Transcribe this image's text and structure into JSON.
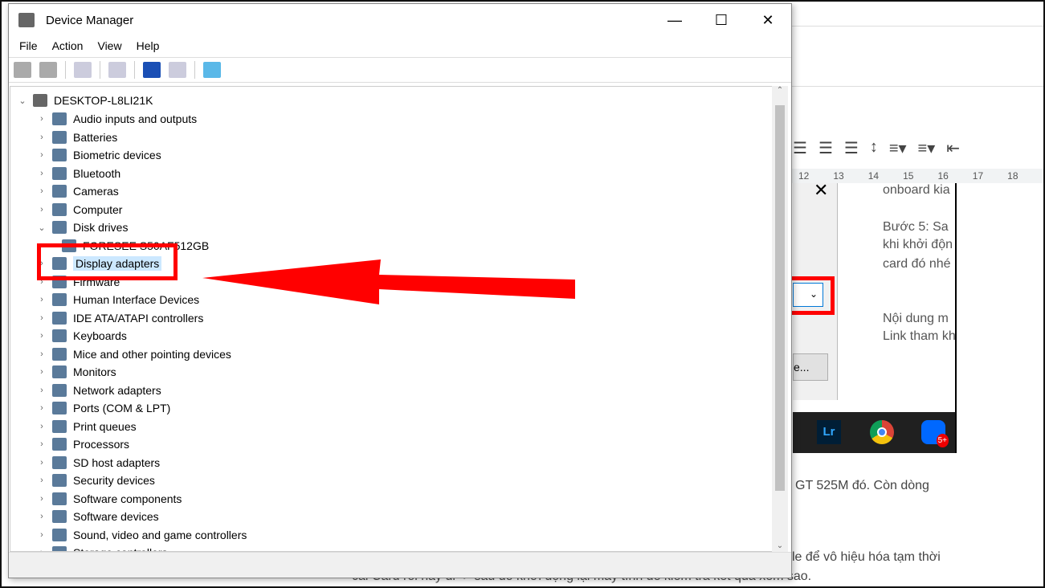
{
  "window": {
    "title": "Device Manager",
    "minimize": "—",
    "maximize": "☐",
    "close": "✕"
  },
  "menu": [
    "File",
    "Action",
    "View",
    "Help"
  ],
  "toolbar": [
    "back-icon",
    "forward-icon",
    "show-hide-console-tree-icon",
    "properties-icon",
    "help-icon",
    "run-icon",
    "scan-hardware-icon"
  ],
  "tree": {
    "root": "DESKTOP-L8LI21K",
    "items": [
      {
        "label": "Audio inputs and outputs"
      },
      {
        "label": "Batteries"
      },
      {
        "label": "Biometric devices"
      },
      {
        "label": "Bluetooth"
      },
      {
        "label": "Cameras"
      },
      {
        "label": "Computer"
      },
      {
        "label": "Disk drives",
        "expanded": true
      },
      {
        "label": "FORESEE S50AF512GB",
        "child": true
      },
      {
        "label": "Display adapters",
        "selected": true
      },
      {
        "label": "Firmware"
      },
      {
        "label": "Human Interface Devices"
      },
      {
        "label": "IDE ATA/ATAPI controllers"
      },
      {
        "label": "Keyboards"
      },
      {
        "label": "Mice and other pointing devices"
      },
      {
        "label": "Monitors"
      },
      {
        "label": "Network adapters"
      },
      {
        "label": "Ports (COM & LPT)"
      },
      {
        "label": "Print queues"
      },
      {
        "label": "Processors"
      },
      {
        "label": "SD host adapters"
      },
      {
        "label": "Security devices"
      },
      {
        "label": "Software components"
      },
      {
        "label": "Software devices"
      },
      {
        "label": "Sound, video and game controllers"
      },
      {
        "label": "Storage controllers"
      }
    ]
  },
  "doc": {
    "ruler": [
      "12",
      "13",
      "14",
      "15",
      "16",
      "17",
      "18"
    ],
    "lines": [
      "onboard kia",
      "Bước 5:  Sa",
      "khi khởi độn",
      "card đó nhé",
      "Nội dung m",
      "Link tham kh"
    ],
    "dialog_button": "e...",
    "taskbar_badge": "5+",
    "taskbar_lr": "Lr",
    "body1": "GT 525M đó. Còn dòng",
    "body2": "le để vô hiệu hóa tạm thời",
    "body3": "cái Card rồi hãy đi -> sau đó khởi động lại máy tính để kiểm tra kết quả xem sao."
  },
  "colors": {
    "annotation": "#ff0000",
    "selection": "#cce8ff"
  }
}
